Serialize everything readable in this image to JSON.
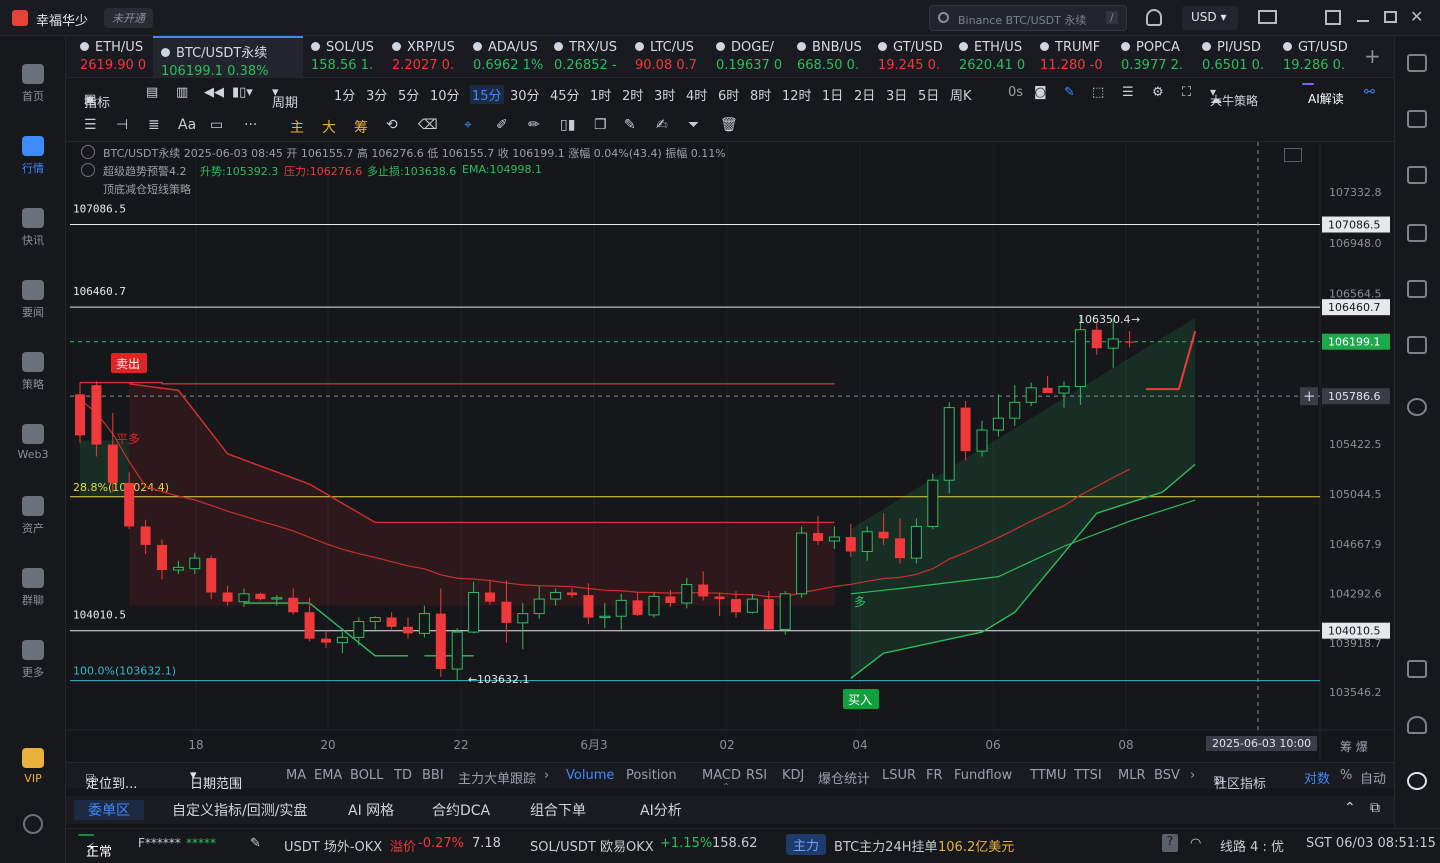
{
  "app": {
    "name": "幸福华少",
    "status": "未开通",
    "search_placeholder": "Binance BTC/USDT 永续",
    "search_shortcut": "/",
    "currency": "USD"
  },
  "sidebar": [
    {
      "label": "首页",
      "icon": "home-icon"
    },
    {
      "label": "行情",
      "icon": "market-icon",
      "active": true
    },
    {
      "label": "快讯",
      "icon": "news-icon"
    },
    {
      "label": "要闻",
      "icon": "headline-icon"
    },
    {
      "label": "策略",
      "icon": "strategy-icon"
    },
    {
      "label": "Web3",
      "icon": "web3-icon"
    },
    {
      "label": "资产",
      "icon": "wallet-icon"
    },
    {
      "label": "群聊",
      "icon": "chat-icon"
    },
    {
      "label": "更多",
      "icon": "more-icon"
    },
    {
      "label": "VIP",
      "icon": "vip-icon"
    }
  ],
  "tabs": [
    {
      "name": "ETH/US",
      "price": "2619.90",
      "chg": "0",
      "dir": "dn"
    },
    {
      "name": "BTC/USDT永续",
      "price": "106199.1",
      "chg": "0.38%",
      "dir": "up",
      "active": true
    },
    {
      "name": "SOL/US",
      "price": "158.56",
      "chg": "1.",
      "dir": "up"
    },
    {
      "name": "XRP/US",
      "price": "2.2027",
      "chg": "0.",
      "dir": "dn"
    },
    {
      "name": "ADA/US",
      "price": "0.6962",
      "chg": "1%",
      "dir": "up"
    },
    {
      "name": "TRX/US",
      "price": "0.26852",
      "chg": "-",
      "dir": "up"
    },
    {
      "name": "LTC/US",
      "price": "90.08",
      "chg": "0.7",
      "dir": "dn"
    },
    {
      "name": "DOGE/",
      "price": "0.19637",
      "chg": "0",
      "dir": "up"
    },
    {
      "name": "BNB/US",
      "price": "668.50",
      "chg": "0.",
      "dir": "up"
    },
    {
      "name": "GT/USD",
      "price": "19.245",
      "chg": "0.",
      "dir": "dn"
    },
    {
      "name": "ETH/US",
      "price": "2620.41",
      "chg": "0",
      "dir": "up"
    },
    {
      "name": "TRUMF",
      "price": "11.280",
      "chg": "-0",
      "dir": "dn"
    },
    {
      "name": "POPCA",
      "price": "0.3977",
      "chg": "2.",
      "dir": "up"
    },
    {
      "name": "PI/USD",
      "price": "0.6501",
      "chg": "0.",
      "dir": "up"
    },
    {
      "name": "GT/USD",
      "price": "19.286",
      "chg": "0.",
      "dir": "up"
    }
  ],
  "toolbar1": {
    "indicator": "指标",
    "period": "周期",
    "intervals": [
      "1分",
      "3分",
      "5分",
      "10分",
      "15分",
      "30分",
      "45分",
      "1时",
      "2时",
      "3时",
      "4时",
      "6时",
      "8时",
      "12时",
      "1日",
      "2日",
      "3日",
      "5日",
      "周K"
    ],
    "active_interval": "15分",
    "countdown": "0s",
    "strategy": "大牛策略",
    "ai": "AI解读"
  },
  "toolbar2": [
    "主",
    "大",
    "筹"
  ],
  "chart_info": {
    "line1": "BTC/USDT永续 2025-06-03 08:45 开 106155.7 高 106276.6 低 106155.7 收 106199.1 涨幅 0.04%(43.4) 振幅 0.11%",
    "line2_a": "超级趋势预警4.2",
    "line2_b": "升势:105392.3",
    "line2_c": "压力:106276.6",
    "line2_d": "多止损:103638.6",
    "line2_e": "EMA:104998.1",
    "line3": "顶底减仓短线策略"
  },
  "chart_data": {
    "type": "candlestick",
    "y_ticks": [
      "107332.8",
      "106948.0",
      "106564.5",
      "105422.5",
      "105044.5",
      "104667.9",
      "104292.6",
      "103918.7",
      "103546.2"
    ],
    "x_ticks": [
      "18",
      "20",
      "22",
      "6月3",
      "02",
      "04",
      "06",
      "08"
    ],
    "cursor_time": "2025-06-03 10:00",
    "last_price": "106199.1",
    "cursor_price": "105786.6",
    "levels": [
      {
        "label": "107086.5",
        "tag": "107086.5"
      },
      {
        "label": "106460.7",
        "tag": "106460.7"
      },
      {
        "label": "104010.5",
        "tag": "104010.5"
      }
    ],
    "fib": [
      {
        "label": "28.8%(105024.4)"
      },
      {
        "label": "100.0%(103632.1)"
      }
    ],
    "annotations": {
      "sell": "卖出",
      "buy": "买入",
      "flat_long": "平多",
      "long": "多",
      "high_mark": "106350.4",
      "low_mark": "103632.1"
    },
    "candles": [
      [
        105800,
        105890,
        105430,
        105490
      ],
      [
        105870,
        105900,
        105330,
        105420
      ],
      [
        105420,
        105660,
        105060,
        105130
      ],
      [
        105130,
        105210,
        104780,
        104800
      ],
      [
        104800,
        104850,
        104590,
        104660
      ],
      [
        104660,
        104700,
        104400,
        104470
      ],
      [
        104470,
        104540,
        104440,
        104490
      ],
      [
        104480,
        104600,
        104440,
        104560
      ],
      [
        104560,
        104580,
        104250,
        104300
      ],
      [
        104300,
        104350,
        104200,
        104230
      ],
      [
        104230,
        104330,
        104190,
        104290
      ],
      [
        104290,
        104300,
        104240,
        104250
      ],
      [
        104250,
        104280,
        104200,
        104260
      ],
      [
        104260,
        104330,
        104130,
        104150
      ],
      [
        104150,
        104260,
        103930,
        103950
      ],
      [
        103950,
        104010,
        103880,
        103920
      ],
      [
        103920,
        104000,
        103840,
        103960
      ],
      [
        103960,
        104110,
        103900,
        104080
      ],
      [
        104080,
        104120,
        104020,
        104110
      ],
      [
        104110,
        104150,
        104020,
        104040
      ],
      [
        104040,
        104110,
        103950,
        103990
      ],
      [
        103990,
        104200,
        103960,
        104140
      ],
      [
        104140,
        104330,
        103660,
        103720
      ],
      [
        103720,
        104030,
        103630,
        104000
      ],
      [
        104000,
        104380,
        103990,
        104300
      ],
      [
        104300,
        104390,
        104210,
        104230
      ],
      [
        104230,
        104390,
        103920,
        104070
      ],
      [
        104070,
        104220,
        103870,
        104140
      ],
      [
        104140,
        104350,
        104100,
        104250
      ],
      [
        104250,
        104330,
        104200,
        104300
      ],
      [
        104300,
        104330,
        104260,
        104280
      ],
      [
        104280,
        104370,
        104060,
        104110
      ],
      [
        104110,
        104220,
        104030,
        104120
      ],
      [
        104120,
        104290,
        104020,
        104240
      ],
      [
        104240,
        104300,
        104120,
        104130
      ],
      [
        104130,
        104300,
        104110,
        104270
      ],
      [
        104270,
        104320,
        104190,
        104220
      ],
      [
        104220,
        104410,
        104180,
        104360
      ],
      [
        104360,
        104460,
        104240,
        104270
      ],
      [
        104270,
        104300,
        104120,
        104250
      ],
      [
        104250,
        104310,
        104110,
        104150
      ],
      [
        104150,
        104290,
        104140,
        104250
      ],
      [
        104250,
        104310,
        104050,
        104020
      ],
      [
        104020,
        104310,
        103980,
        104290
      ],
      [
        104290,
        104800,
        104260,
        104750
      ],
      [
        104750,
        104880,
        104660,
        104690
      ],
      [
        104690,
        104800,
        104630,
        104720
      ],
      [
        104720,
        104820,
        104570,
        104610
      ],
      [
        104610,
        104800,
        104540,
        104760
      ],
      [
        104760,
        104900,
        104660,
        104710
      ],
      [
        104710,
        104860,
        104520,
        104560
      ],
      [
        104560,
        104860,
        104520,
        104800
      ],
      [
        104800,
        105200,
        104780,
        105150
      ],
      [
        105150,
        105740,
        105050,
        105700
      ],
      [
        105700,
        105750,
        105300,
        105370
      ],
      [
        105370,
        105600,
        105330,
        105530
      ],
      [
        105530,
        105800,
        105480,
        105620
      ],
      [
        105620,
        105870,
        105560,
        105740
      ],
      [
        105740,
        105890,
        105710,
        105850
      ],
      [
        105850,
        105940,
        105820,
        105810
      ],
      [
        105810,
        105900,
        105700,
        105860
      ],
      [
        105860,
        106400,
        105720,
        106290
      ],
      [
        106290,
        106350,
        106100,
        106150
      ],
      [
        106150,
        106380,
        106000,
        106220
      ],
      [
        106200,
        106280,
        106156,
        106199
      ]
    ]
  },
  "indicators": {
    "locate": "定位到...",
    "range": "日期范围",
    "items": [
      "MA",
      "EMA",
      "BOLL",
      "TD",
      "BBI",
      "主力大单跟踪",
      "Volume",
      "Position",
      "MACD",
      "RSI",
      "KDJ",
      "爆仓统计",
      "LSUR",
      "FR",
      "Fundflow",
      "TTMU",
      "TTSI",
      "MLR",
      "BSV"
    ],
    "active": "Volume",
    "community": "社区指标",
    "compare": "对数",
    "percent": "%",
    "auto": "自动"
  },
  "bottom_tabs": [
    "委单区",
    "自定义指标/回测/实盘",
    "AI 网格",
    "合约DCA",
    "组合下单",
    "AI分析"
  ],
  "status": {
    "state": "正常",
    "user": "F******",
    "stars": "*****",
    "otc": "USDT 场外-OKX",
    "premium_label": "溢价",
    "premium": "-0.27%",
    "otc_price": "7.18",
    "pair2": "SOL/USDT 欧易OKX",
    "pair2_chg": "+1.15%",
    "pair2_price": "158.62",
    "main_label": "主力",
    "main_text": "BTC主力24H挂单",
    "main_value": "106.2亿美元",
    "line": "线路 4 : 优",
    "time": "SGT 06/03 08:51:15"
  }
}
